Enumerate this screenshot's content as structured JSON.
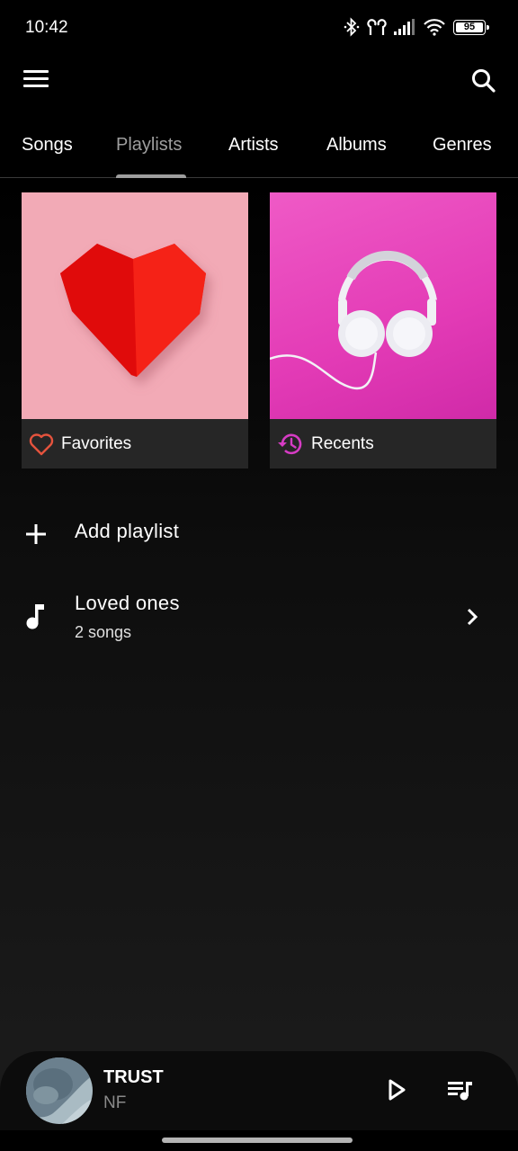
{
  "status_bar": {
    "time": "10:42",
    "battery": "95",
    "icons": [
      "bluetooth-icon",
      "earbuds-icon",
      "signal-icon",
      "wifi-icon",
      "battery-icon"
    ]
  },
  "app_bar": {
    "menu_icon": "menu-icon",
    "search_icon": "search-icon"
  },
  "tabs": [
    {
      "label": "Songs",
      "active": false
    },
    {
      "label": "Playlists",
      "active": true
    },
    {
      "label": "Artists",
      "active": false
    },
    {
      "label": "Albums",
      "active": false
    },
    {
      "label": "Genres",
      "active": false
    }
  ],
  "cards": [
    {
      "label": "Favorites",
      "icon": "heart-outline-icon",
      "icon_color": "#e5533d",
      "art_bg": "#f2aab6"
    },
    {
      "label": "Recents",
      "icon": "history-icon",
      "icon_color": "#d63cc4",
      "art_bg": "#e63fb9"
    }
  ],
  "list": {
    "add_playlist": "Add playlist",
    "playlists": [
      {
        "title": "Loved ones",
        "subtitle": "2 songs"
      }
    ]
  },
  "mini_player": {
    "title": "TRUST",
    "artist": "NF",
    "play_icon": "play-icon",
    "queue_icon": "queue-music-icon"
  },
  "colors": {
    "accent_tab": "#9e9e9e",
    "favorites": "#e5533d",
    "recents": "#d63cc4"
  }
}
